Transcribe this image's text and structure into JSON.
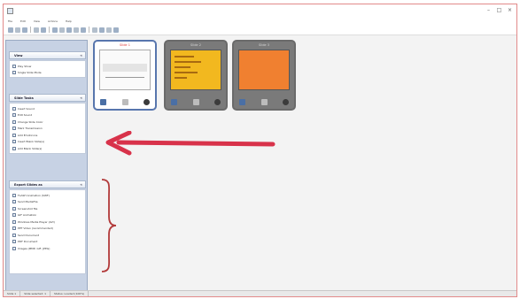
{
  "window": {
    "menu": [
      "File",
      "Edit",
      "View",
      "Actions",
      "Help"
    ],
    "controls": [
      "–",
      "□",
      "×"
    ]
  },
  "sidebar": {
    "view_panel": {
      "title": "View",
      "items": [
        "Play Show",
        "Single Slide Mode"
      ]
    },
    "slide_tasks_panel": {
      "title": "Slide Tasks",
      "items": [
        "Insert Sound",
        "Edit Sound",
        "Change Slide Color",
        "Mark Transmission",
        "Add Emoticons",
        "Insert Blank Slide(s)",
        "Add Blank Slide(s)"
      ]
    },
    "export_panel": {
      "title": "Export Slides as",
      "items": [
        "FLASH Animation (SWF)",
        "Send MediaFile",
        "Screenshot file",
        "GIF Animation",
        "Windows Media Player (AVI)",
        "PPT Video (recommended)",
        "Send Document",
        "PDF Document",
        "Images (BMP, GIF, JPEG)"
      ]
    },
    "colors": {
      "background": "#c7d2e4",
      "border": "#9aaac3"
    }
  },
  "slides": [
    {
      "label": "Slide 1",
      "selected": true,
      "thumbnail": "white"
    },
    {
      "label": "Slide 2",
      "selected": false,
      "thumbnail": "yellow"
    },
    {
      "label": "Slide 3",
      "selected": false,
      "thumbnail": "orange"
    }
  ],
  "annotations": {
    "arrow_color": "#d8324a",
    "brace_color": "#b23a3a"
  },
  "statusbar": {
    "cells": [
      "Slide 1",
      "Slide selected: 1",
      "Status: Loaded (100%)"
    ]
  }
}
